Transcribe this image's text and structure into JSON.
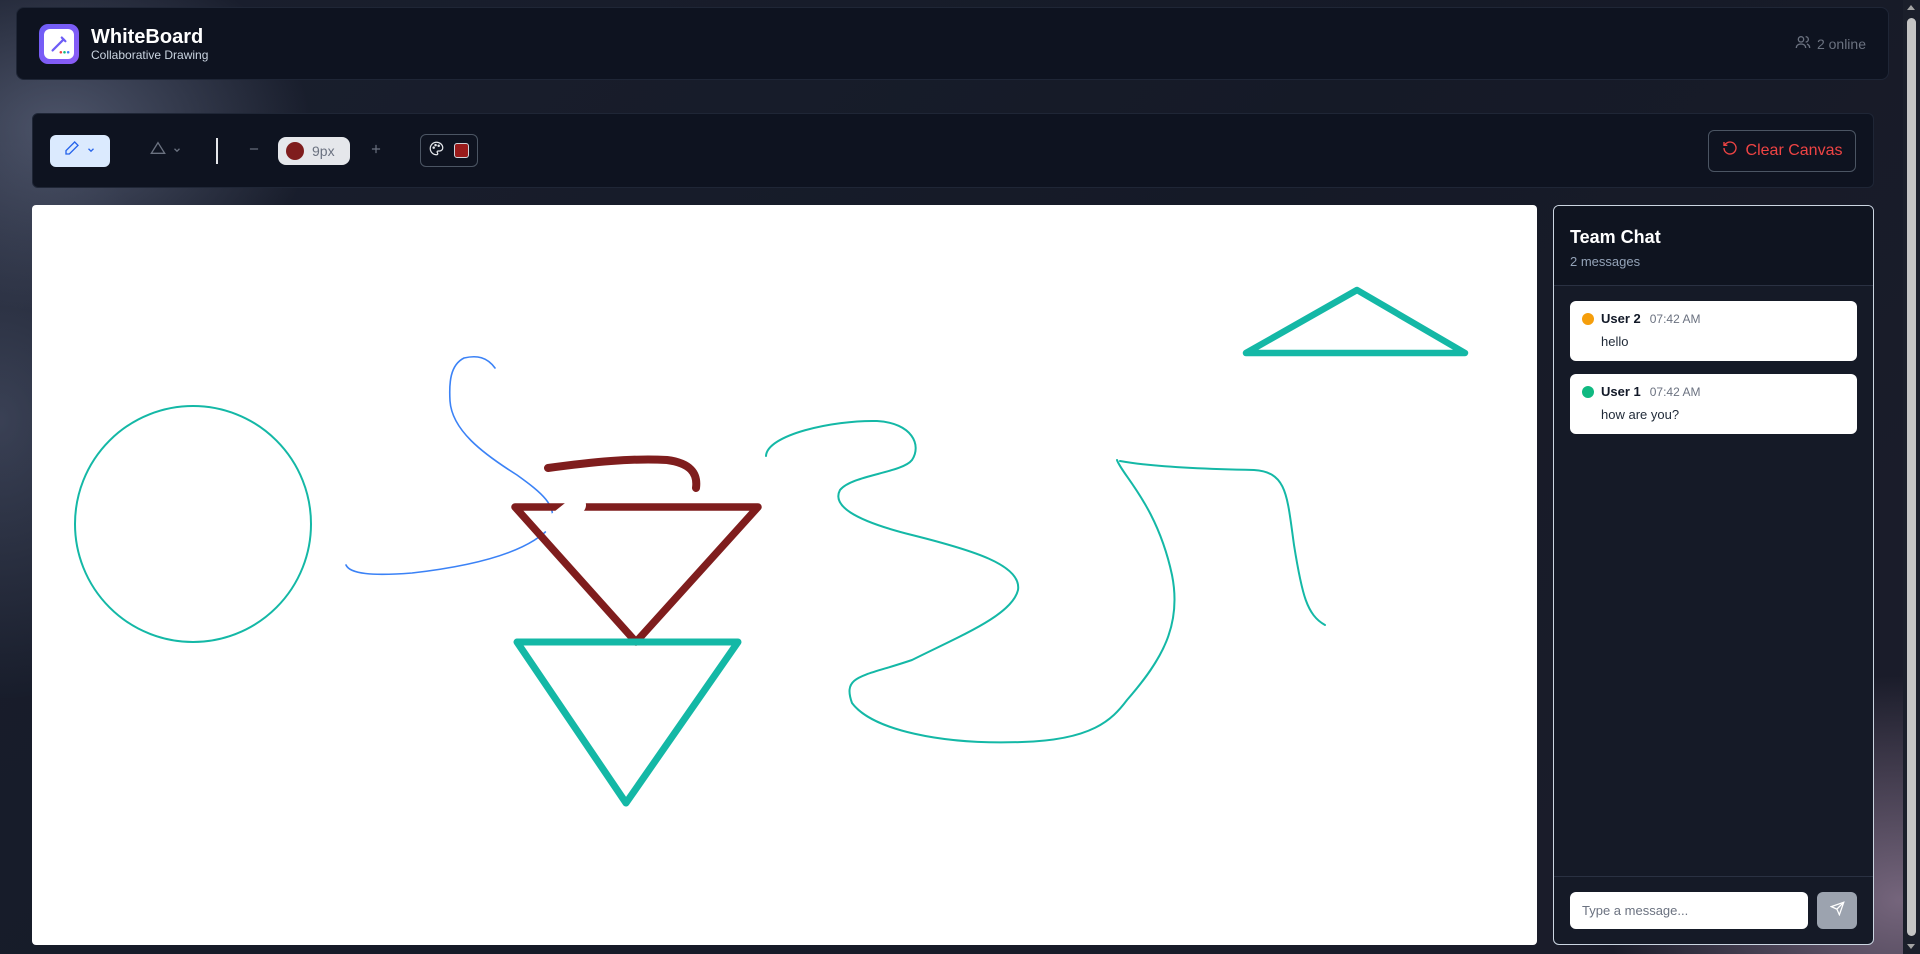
{
  "app": {
    "title": "WhiteBoard",
    "subtitle": "Collaborative Drawing",
    "online": "2 online"
  },
  "toolbar": {
    "brush_size": "9px",
    "current_color": "#7f1d1d",
    "clear_label": "Clear Canvas",
    "icons": [
      "pencil-icon",
      "triangle-icon",
      "minus-icon",
      "plus-icon",
      "palette-icon",
      "rotate-ccw-icon"
    ]
  },
  "chat": {
    "title": "Team Chat",
    "count": "2 messages",
    "messages": [
      {
        "user": "User 2",
        "time": "07:42 AM",
        "text": "hello",
        "color": "#f59e0b"
      },
      {
        "user": "User 1",
        "time": "07:42 AM",
        "text": "how are you?",
        "color": "#10b981"
      }
    ],
    "input_placeholder": "Type a message..."
  },
  "colors": {
    "teal": "#14b8a6",
    "maroon": "#7f1d1d",
    "blue": "#3b82f6",
    "danger": "#ef4444"
  }
}
